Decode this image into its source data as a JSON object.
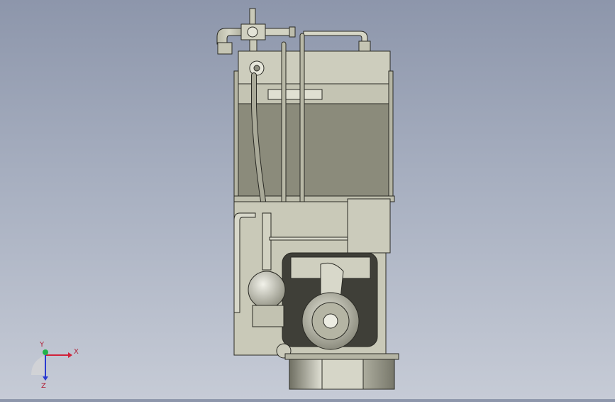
{
  "viewport": {
    "background_top": "#8d96ab",
    "background_bottom": "#c6cbd6",
    "model_color": "#c9c9b8",
    "panel_color": "#8b8b7b",
    "outline_color": "#2a2a24"
  },
  "triad": {
    "x_label": "X",
    "y_label": "Y",
    "z_label": "Z",
    "x_color": "#d0223a",
    "y_color": "#22b24a",
    "z_color": "#2a3ad0"
  }
}
